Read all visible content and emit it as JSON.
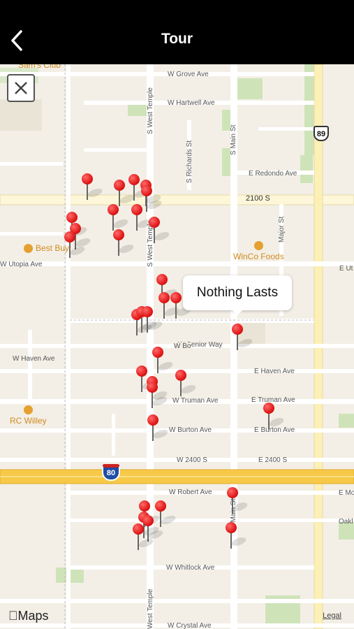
{
  "navbar": {
    "title": "Tour"
  },
  "map": {
    "callout": "Nothing Lasts",
    "attribution": "Maps",
    "legal": "Legal",
    "streets": {
      "w_grove": "W Grove Ave",
      "w_hartwell": "W Hartwell Ave",
      "e_redondo": "E Redondo Ave",
      "s2100": "2100 S",
      "w_utopia": "W Utopia Ave",
      "e_ut": "E Ut",
      "w_senior": "W Senior Way",
      "w_haven": "W Haven Ave",
      "e_haven": "E Haven Ave",
      "w_truman": "W Truman Ave",
      "e_truman": "E Truman Ave",
      "w_burton": "W Burton Ave",
      "e_burton": "E Burton Ave",
      "w2400": "W 2400 S",
      "e2400": "E 2400 S",
      "w_robert": "W Robert Ave",
      "e_mo": "E Mo",
      "oakl": "Oakl",
      "w_whitlock": "W Whitlock Ave",
      "w_crystal": "W Crystal Ave",
      "s_west_temple_top": "S West Temple",
      "s_west_temple_mid": "S West Temple",
      "s_west_temple_bot": "West Temple",
      "s_richards": "S Richards St",
      "s_main": "S Main St",
      "s_main_bot": "S Main St",
      "major_st": "Major St",
      "w_bo": "W Bo"
    },
    "pois": {
      "sams_club": "Sam's Club",
      "best_buy": "Best Buy",
      "winco": "WinCo Foods",
      "rc_willey": "RC Willey"
    },
    "highways": {
      "us89": "89",
      "i80": "80"
    },
    "pin_count": 33
  }
}
